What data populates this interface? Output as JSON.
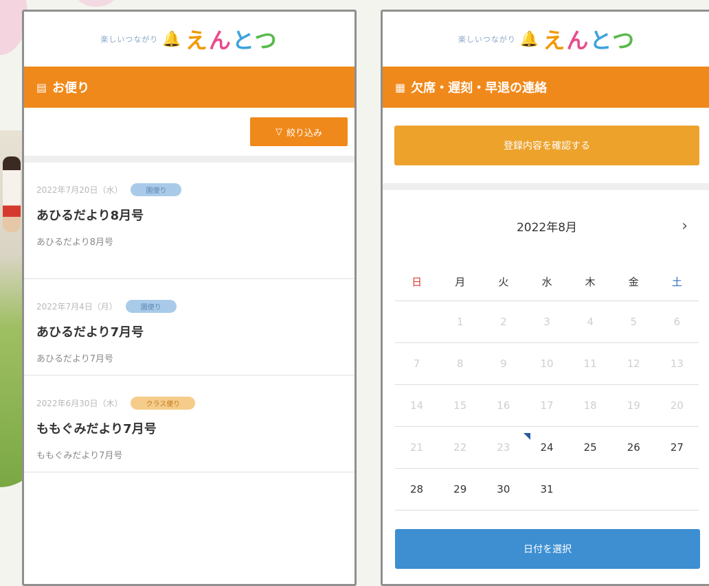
{
  "brand": {
    "tagline": "楽しいつながり",
    "name_chars": [
      "え",
      "ん",
      "と",
      "つ"
    ]
  },
  "left": {
    "section_title": "お便り",
    "filter_label": "絞り込み",
    "items": [
      {
        "date": "2022年7月20日（水）",
        "badge": "園便り",
        "badge_color": "blue",
        "title": "あひるだより8月号",
        "subtitle": "あひるだより8月号"
      },
      {
        "date": "2022年7月4日（月）",
        "badge": "園便り",
        "badge_color": "blue",
        "title": "あひるだより7月号",
        "subtitle": "あひるだより7月号"
      },
      {
        "date": "2022年6月30日（木）",
        "badge": "クラス便り",
        "badge_color": "orange",
        "title": "ももぐみだより7月号",
        "subtitle": "ももぐみだより7月号"
      }
    ]
  },
  "right": {
    "section_title": "欠席・遅刻・早退の連絡",
    "confirm_button": "登録内容を確認する",
    "calendar": {
      "month_label": "2022年8月",
      "next_icon": "chevron-right",
      "weekdays": [
        "日",
        "月",
        "火",
        "水",
        "木",
        "金",
        "土"
      ],
      "weeks": [
        [
          "",
          "1",
          "2",
          "3",
          "4",
          "5",
          "6"
        ],
        [
          "7",
          "8",
          "9",
          "10",
          "11",
          "12",
          "13"
        ],
        [
          "14",
          "15",
          "16",
          "17",
          "18",
          "19",
          "20"
        ],
        [
          "21",
          "22",
          "23",
          "24",
          "25",
          "26",
          "27"
        ],
        [
          "28",
          "29",
          "30",
          "31",
          "",
          "",
          ""
        ]
      ],
      "first_selectable_day": 24,
      "today": 24
    },
    "select_button": "日付を選択"
  },
  "colors": {
    "accent_orange": "#f0891b",
    "confirm_orange": "#eda22c",
    "select_blue": "#3d8fd2",
    "sunday_red": "#d93a2f",
    "saturday_blue": "#2f6fc4"
  }
}
